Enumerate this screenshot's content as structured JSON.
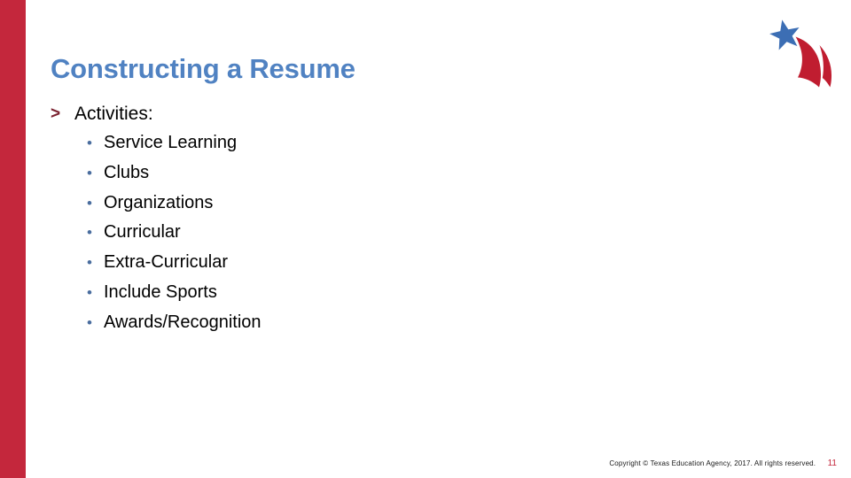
{
  "slide": {
    "title": "Constructing a Resume",
    "accent_color": "#c4273c",
    "title_color": "#5082c2",
    "bullet_color": "#4a6d9e",
    "chevron_color": "#7b2230",
    "background_color": "#ffffff"
  },
  "content": {
    "level1": {
      "marker": ">",
      "label": "Activities:"
    },
    "bullets": [
      {
        "marker": "•",
        "label": "Service Learning"
      },
      {
        "marker": "•",
        "label": "Clubs"
      },
      {
        "marker": "•",
        "label": "Organizations"
      },
      {
        "marker": "•",
        "label": "Curricular"
      },
      {
        "marker": "•",
        "label": "Extra-Curricular"
      },
      {
        "marker": "•",
        "label": "Include Sports"
      },
      {
        "marker": "•",
        "label": "Awards/Recognition"
      }
    ]
  },
  "footer": {
    "copyright": "Copyright © Texas Education Agency, 2017. All rights reserved.",
    "page_number": "11",
    "page_number_color": "#c4273c"
  },
  "logo": {
    "name": "texas-education-agency-logo",
    "star_color": "#3c6eb4",
    "swoosh_color": "#c01d30"
  }
}
